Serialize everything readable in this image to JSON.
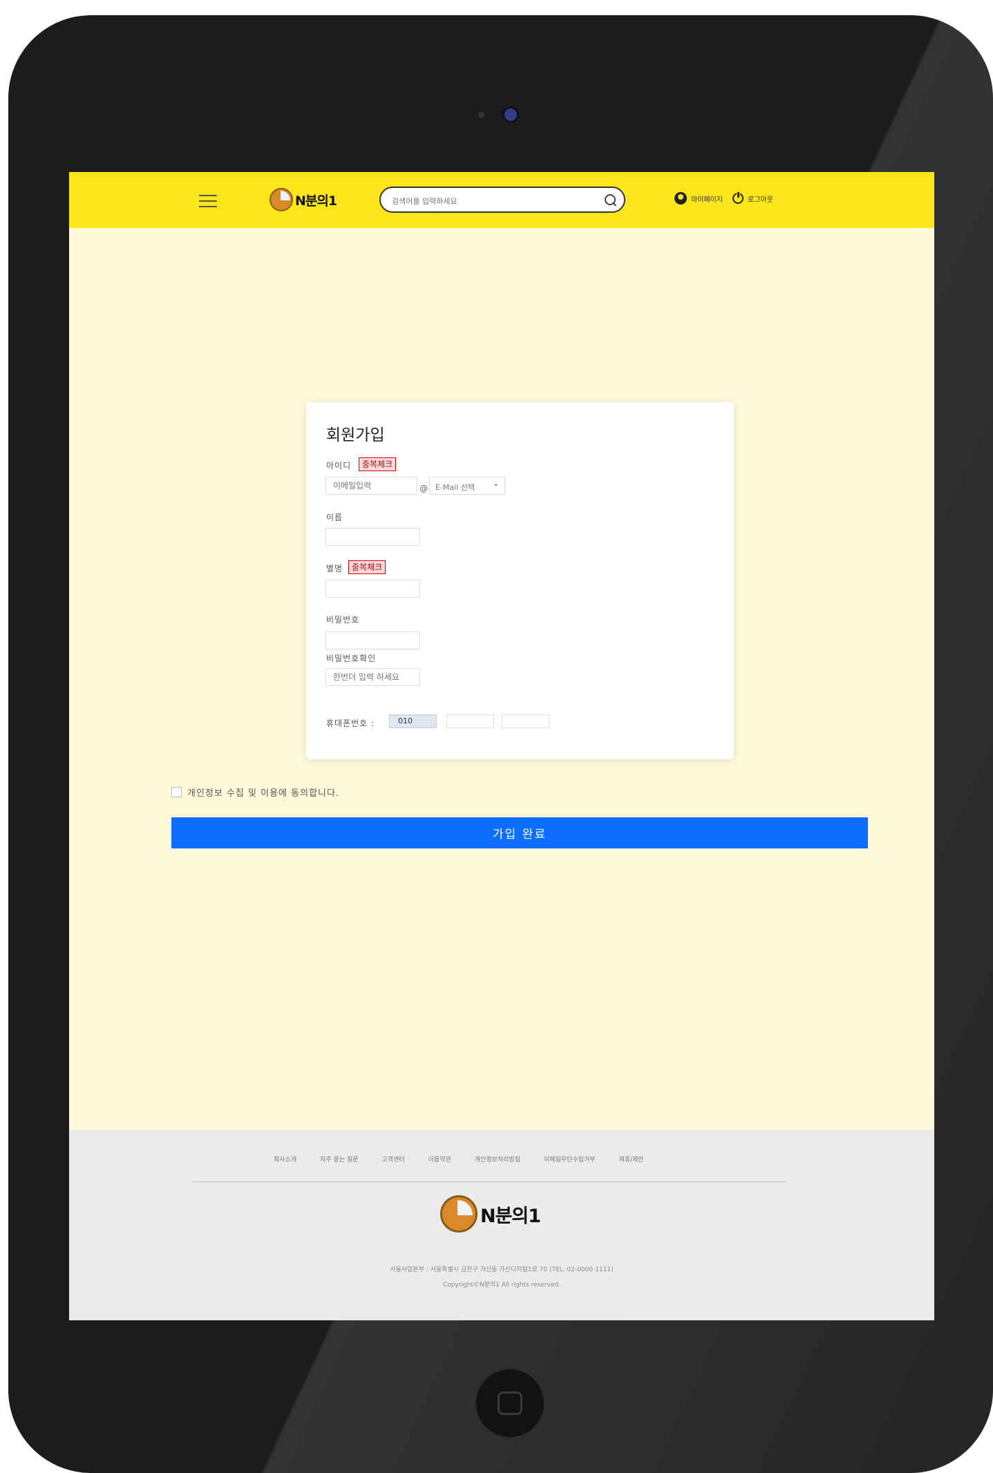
{
  "header": {
    "logo_text": "N분의1",
    "search_placeholder": "검색어를 입력하세요",
    "mypage_label": "마이페이지",
    "logout_label": "로그아웃"
  },
  "form": {
    "title": "회원가입",
    "id_label": "아이디",
    "dup_check_label": "중복체크",
    "email_local_placeholder": "이메일입력",
    "at_sign": "@",
    "email_domain_select": "E-Mail 선택",
    "name_label": "이름",
    "nickname_label": "별명",
    "nickname_dup_check_label": "중복체크",
    "password_label": "비밀번호",
    "password_confirm_label": "비밀번호확인",
    "password_confirm_placeholder": "한번더 입력 하세요",
    "phone_label": "휴대폰번호 :",
    "phone_prefix": "010"
  },
  "agreement": {
    "label": "개인정보 수집 및 이용에 동의합니다."
  },
  "submit_label": "가입 완료",
  "footer": {
    "links": [
      "회사소개",
      "자주 묻는 질문",
      "고객센터",
      "이용약관",
      "개인정보처리방침",
      "이메일무단수집거부",
      "제휴/제안"
    ],
    "logo_text": "N분의1",
    "address": "서울사업본부 : 서울특별시 금천구 가산동 가산디지털1로 70 (TEL. 02-0000-1111)",
    "copyright": "Copyright©N분의1 All rights reserved."
  },
  "colors": {
    "header_bg": "#fce518",
    "page_bg": "#fef9d8",
    "submit_bg": "#0d6efd",
    "footer_bg": "#ebebeb"
  }
}
